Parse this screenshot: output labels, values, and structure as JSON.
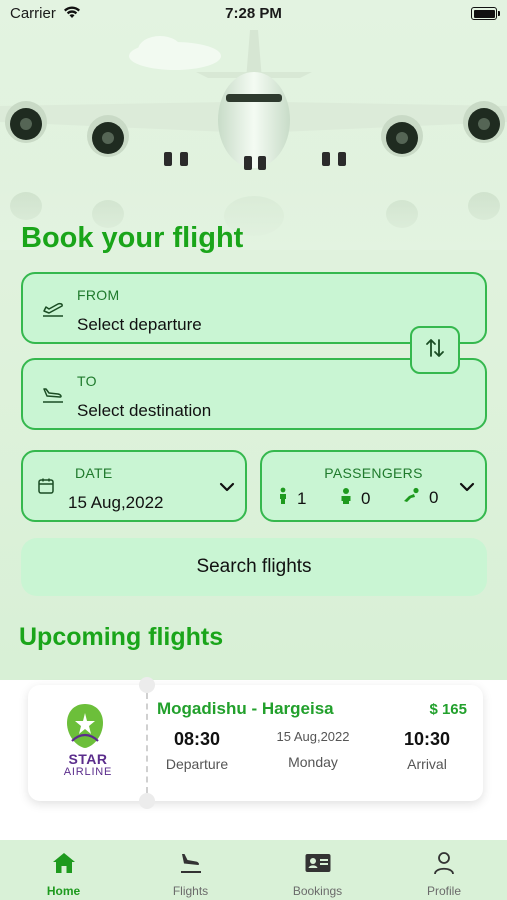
{
  "status_bar": {
    "carrier": "Carrier",
    "time": "7:28 PM"
  },
  "page_title": "Book your flight",
  "from": {
    "label": "FROM",
    "value": "Select departure"
  },
  "to": {
    "label": "TO",
    "value": "Select destination"
  },
  "date": {
    "label": "DATE",
    "value": "15 Aug,2022"
  },
  "passengers": {
    "label": "PASSENGERS",
    "adults": "1",
    "children": "0",
    "infants": "0"
  },
  "search_button": "Search flights",
  "upcoming_title": "Upcoming flights",
  "upcoming": {
    "airline": {
      "star": "STAR",
      "airline": "AIRLINE"
    },
    "route": "Mogadishu - Hargeisa",
    "price": "$ 165",
    "departure_time": "08:30",
    "departure_label": "Departure",
    "date": "15 Aug,2022",
    "weekday": "Monday",
    "arrival_time": "10:30",
    "arrival_label": "Arrival"
  },
  "tabs": [
    {
      "label": "Home",
      "icon": "home-icon",
      "active": true
    },
    {
      "label": "Flights",
      "icon": "flight-landing-icon",
      "active": false
    },
    {
      "label": "Bookings",
      "icon": "id-card-icon",
      "active": false
    },
    {
      "label": "Profile",
      "icon": "person-icon",
      "active": false
    }
  ],
  "colors": {
    "accent": "#1aa51a",
    "field_bg": "#c9f5d3",
    "field_border": "#35b84e",
    "brand_purple": "#5b2d8c"
  }
}
